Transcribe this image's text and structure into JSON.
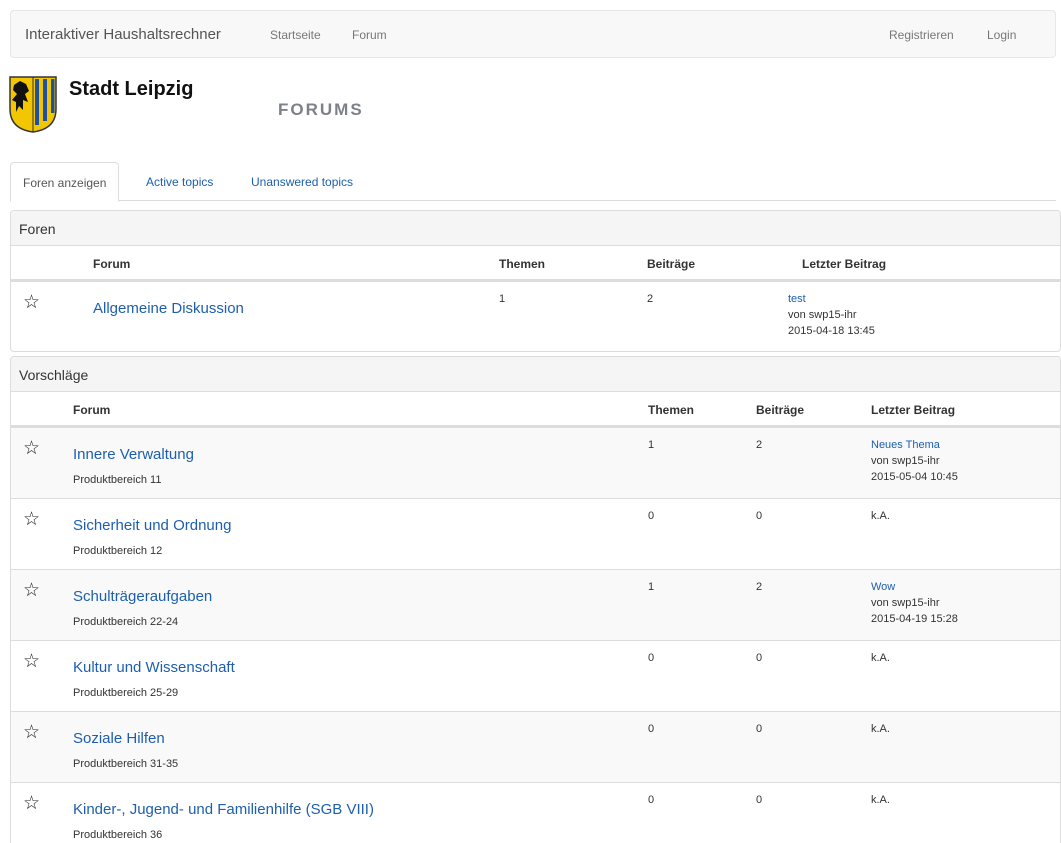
{
  "navbar": {
    "brand": "Interaktiver Haushaltsrechner",
    "links": [
      "Startseite",
      "Forum"
    ],
    "right_links": [
      "Registrieren",
      "Login"
    ]
  },
  "header": {
    "city": "Stadt Leipzig",
    "heading": "FORUMS"
  },
  "tabs": [
    "Foren anzeigen",
    "Active topics",
    "Unanswered topics"
  ],
  "panels": [
    {
      "title": "Foren",
      "columns": [
        "Forum",
        "Themen",
        "Beiträge",
        "Letzter Beitrag"
      ],
      "rows": [
        {
          "name": "Allgemeine Diskussion",
          "themen": "1",
          "beitraege": "2",
          "last_title": "test",
          "last_by": "von swp15-ihr",
          "last_date": "2015-04-18 13:45"
        }
      ]
    },
    {
      "title": "Vorschläge",
      "columns": [
        "Forum",
        "Themen",
        "Beiträge",
        "Letzter Beitrag"
      ],
      "rows": [
        {
          "name": "Innere Verwaltung",
          "desc": "Produktbereich 11",
          "themen": "1",
          "beitraege": "2",
          "last_title": "Neues Thema",
          "last_by": "von swp15-ihr",
          "last_date": "2015-05-04 10:45"
        },
        {
          "name": "Sicherheit und Ordnung",
          "desc": "Produktbereich 12",
          "themen": "0",
          "beitraege": "0",
          "last_none": "k.A."
        },
        {
          "name": "Schulträgeraufgaben",
          "desc": "Produktbereich 22-24",
          "themen": "1",
          "beitraege": "2",
          "last_title": "Wow",
          "last_by": "von swp15-ihr",
          "last_date": "2015-04-19 15:28"
        },
        {
          "name": "Kultur und Wissenschaft",
          "desc": "Produktbereich 25-29",
          "themen": "0",
          "beitraege": "0",
          "last_none": "k.A."
        },
        {
          "name": "Soziale Hilfen",
          "desc": "Produktbereich 31-35",
          "themen": "0",
          "beitraege": "0",
          "last_none": "k.A."
        },
        {
          "name": "Kinder-, Jugend- und Familienhilfe (SGB VIII)",
          "desc": "Produktbereich 36",
          "themen": "0",
          "beitraege": "0",
          "last_none": "k.A."
        }
      ]
    }
  ],
  "icons": {
    "favorite": "star-outline-icon",
    "logo": "leipzig-coat-of-arms"
  },
  "colors": {
    "link": "#1d5fae",
    "navbar_bg": "#f8f8f8",
    "logo_yellow": "#f2c600",
    "logo_blue": "#1f4fa0"
  }
}
